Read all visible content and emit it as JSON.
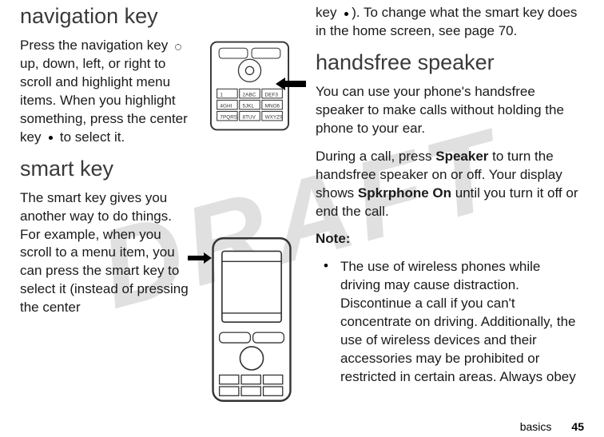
{
  "watermark": "DRAFT",
  "left_column": {
    "section1": {
      "heading": "navigation key",
      "paragraph_before_icon": "Press the navigation key ",
      "paragraph_mid": " up, down, left, or right to scroll and highlight menu items. When you highlight something, press the center key ",
      "paragraph_after": " to select it."
    },
    "section2": {
      "heading": "smart key",
      "paragraph": "The smart key gives you another way to do things. For example, when you scroll to a menu item, you can press the smart key to select it (instead of pressing the center"
    }
  },
  "right_column": {
    "continuation_before": "key ",
    "continuation_after": "). To change what the smart key does in the home screen, see page 70.",
    "section1": {
      "heading": "handsfree speaker",
      "paragraph1": "You can use your phone's handsfree speaker to make calls without holding the phone to your ear.",
      "paragraph2_before": "During a call, press ",
      "paragraph2_bold1": "Speaker",
      "paragraph2_mid": " to turn the handsfree speaker on or off. Your display shows ",
      "paragraph2_bold2": "Spkrphone On",
      "paragraph2_after": " until you turn it off or end the call.",
      "note_label": "Note:",
      "bullet1": "The use of wireless phones while driving may cause distraction. Discontinue a call if you can't concentrate on driving. Additionally, the use of wireless devices and their accessories may be prohibited or restricted in certain areas. Always obey"
    }
  },
  "footer": {
    "label": "basics",
    "page": "45"
  }
}
